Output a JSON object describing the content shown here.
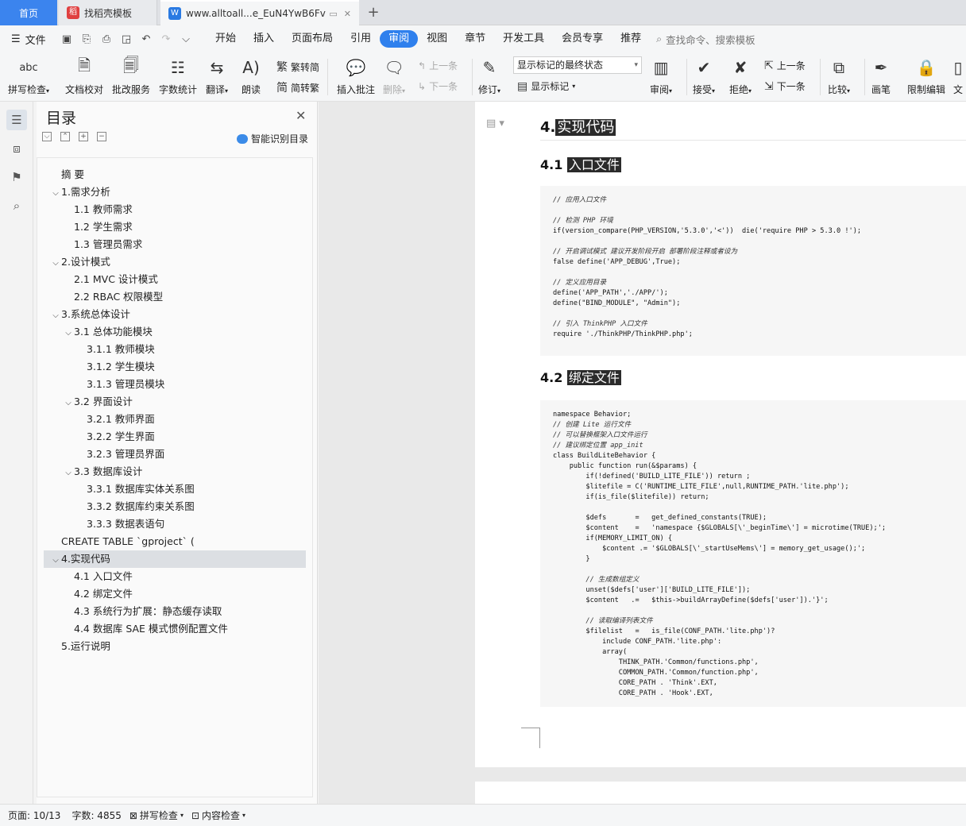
{
  "tabs": {
    "home": "首页",
    "template": "找稻壳模板",
    "document": "www.alltoall...e_EuN4YwB6Fv",
    "add": "+"
  },
  "menu": {
    "file": "文件",
    "tabs": [
      "开始",
      "插入",
      "页面布局",
      "引用",
      "审阅",
      "视图",
      "章节",
      "开发工具",
      "会员专享",
      "推荐"
    ],
    "active_tab": "审阅",
    "search": "查找命令、搜索模板"
  },
  "ribbon": {
    "spellcheck": "拼写检查",
    "doc_proof": "文档校对",
    "batch_service": "批改服务",
    "word_count": "字数统计",
    "translate": "翻译",
    "read_aloud": "朗读",
    "to_traditional": "繁转简",
    "to_simplified": "简转繁",
    "insert_comment": "插入批注",
    "delete": "删除",
    "prev_comment": "上一条",
    "next_comment": "下一条",
    "track_changes": "修订",
    "markup_state": "显示标记的最终状态",
    "show_markup": "显示标记",
    "review": "审阅",
    "accept": "接受",
    "reject": "拒绝",
    "prev_change": "上一条",
    "next_change": "下一条",
    "compare": "比较",
    "pen": "画笔",
    "restrict_edit": "限制编辑",
    "doc_rights": "文"
  },
  "toc": {
    "title": "目录",
    "smart_recognize": "智能识别目录",
    "items": [
      {
        "text": "摘 要",
        "level": 1,
        "exp": ""
      },
      {
        "text": "1.需求分析",
        "level": 1,
        "exp": "⌵"
      },
      {
        "text": "1.1 教师需求",
        "level": 2,
        "exp": ""
      },
      {
        "text": "1.2 学生需求",
        "level": 2,
        "exp": ""
      },
      {
        "text": "1.3 管理员需求",
        "level": 2,
        "exp": ""
      },
      {
        "text": "2.设计模式",
        "level": 1,
        "exp": "⌵"
      },
      {
        "text": "2.1 MVC 设计模式",
        "level": 2,
        "exp": ""
      },
      {
        "text": "2.2 RBAC 权限模型",
        "level": 2,
        "exp": ""
      },
      {
        "text": "3.系统总体设计",
        "level": 1,
        "exp": "⌵"
      },
      {
        "text": "3.1 总体功能模块",
        "level": 2,
        "exp": "⌵"
      },
      {
        "text": "3.1.1 教师模块",
        "level": 3,
        "exp": ""
      },
      {
        "text": "3.1.2 学生模块",
        "level": 3,
        "exp": ""
      },
      {
        "text": "3.1.3 管理员模块",
        "level": 3,
        "exp": ""
      },
      {
        "text": "3.2 界面设计",
        "level": 2,
        "exp": "⌵"
      },
      {
        "text": "3.2.1 教师界面",
        "level": 3,
        "exp": ""
      },
      {
        "text": "3.2.2 学生界面",
        "level": 3,
        "exp": ""
      },
      {
        "text": "3.2.3 管理员界面",
        "level": 3,
        "exp": ""
      },
      {
        "text": "3.3 数据库设计",
        "level": 2,
        "exp": "⌵"
      },
      {
        "text": "3.3.1 数据库实体关系图",
        "level": 3,
        "exp": ""
      },
      {
        "text": "3.3.2 数据库约束关系图",
        "level": 3,
        "exp": ""
      },
      {
        "text": "3.3.3 数据表语句",
        "level": 3,
        "exp": ""
      },
      {
        "text": "CREATE TABLE `gproject` (",
        "level": 1,
        "exp": ""
      },
      {
        "text": "4.实现代码",
        "level": 1,
        "exp": "⌵"
      },
      {
        "text": "4.1 入口文件",
        "level": 2,
        "exp": ""
      },
      {
        "text": "4.2 绑定文件",
        "level": 2,
        "exp": ""
      },
      {
        "text": "4.3 系统行为扩展：静态缓存读取",
        "level": 2,
        "exp": ""
      },
      {
        "text": "4.4 数据库 SAE 模式惯例配置文件",
        "level": 2,
        "exp": ""
      },
      {
        "text": "5.运行说明",
        "level": 1,
        "exp": ""
      }
    ],
    "selected_index": 22
  },
  "document": {
    "h1_num": "4.",
    "h1_text": "实现代码",
    "h2a_num": "4.1 ",
    "h2a_text": "入口文件",
    "h2b_num": "4.2 ",
    "h2b_text": "绑定文件",
    "code_entry": [
      {
        "t": "// 应用入口文件",
        "c": true
      },
      {
        "t": "",
        "c": false
      },
      {
        "t": "// 检测 PHP 环境",
        "c": true
      },
      {
        "t": "if(version_compare(PHP_VERSION,'5.3.0','<'))  die('require PHP > 5.3.0 !');",
        "c": false
      },
      {
        "t": "",
        "c": false
      },
      {
        "t": "// 开启调试模式 建议开发阶段开启 部署阶段注释或者设为",
        "c": true
      },
      {
        "t": "false define('APP_DEBUG',True);",
        "c": false
      },
      {
        "t": "",
        "c": false
      },
      {
        "t": "// 定义应用目录",
        "c": true
      },
      {
        "t": "define('APP_PATH','./APP/');",
        "c": false
      },
      {
        "t": "define(\"BIND_MODULE\", \"Admin\");",
        "c": false
      },
      {
        "t": "",
        "c": false
      },
      {
        "t": "// 引入 ThinkPHP 入口文件",
        "c": true
      },
      {
        "t": "require './ThinkPHP/ThinkPHP.php';",
        "c": false
      }
    ],
    "code_bind": [
      {
        "t": "namespace Behavior;",
        "c": false
      },
      {
        "t": "// 创建 Lite 运行文件",
        "c": true
      },
      {
        "t": "// 可以替换框架入口文件运行",
        "c": true
      },
      {
        "t": "// 建议绑定位置 app_init",
        "c": true
      },
      {
        "t": "class BuildLiteBehavior {",
        "c": false
      },
      {
        "t": "    public function run(&$params) {",
        "c": false
      },
      {
        "t": "        if(!defined('BUILD_LITE_FILE')) return ;",
        "c": false
      },
      {
        "t": "        $litefile = C('RUNTIME_LITE_FILE',null,RUNTIME_PATH.'lite.php');",
        "c": false
      },
      {
        "t": "        if(is_file($litefile)) return;",
        "c": false
      },
      {
        "t": "",
        "c": false
      },
      {
        "t": "        $defs       =   get_defined_constants(TRUE);",
        "c": false
      },
      {
        "t": "        $content    =   'namespace {$GLOBALS[\\'_beginTime\\'] = microtime(TRUE);';",
        "c": false
      },
      {
        "t": "        if(MEMORY_LIMIT_ON) {",
        "c": false
      },
      {
        "t": "            $content .= '$GLOBALS[\\'_startUseMems\\'] = memory_get_usage();';",
        "c": false
      },
      {
        "t": "        }",
        "c": false
      },
      {
        "t": "",
        "c": false
      },
      {
        "t": "        // 生成数组定义",
        "c": true
      },
      {
        "t": "        unset($defs['user']['BUILD_LITE_FILE']);",
        "c": false
      },
      {
        "t": "        $content   .=   $this->buildArrayDefine($defs['user']).'}';",
        "c": false
      },
      {
        "t": "",
        "c": false
      },
      {
        "t": "        // 读取编译列表文件",
        "c": true
      },
      {
        "t": "        $filelist   =   is_file(CONF_PATH.'lite.php')?",
        "c": false
      },
      {
        "t": "            include CONF_PATH.'lite.php':",
        "c": false
      },
      {
        "t": "            array(",
        "c": false
      },
      {
        "t": "                THINK_PATH.'Common/functions.php',",
        "c": false
      },
      {
        "t": "                COMMON_PATH.'Common/function.php',",
        "c": false
      },
      {
        "t": "                CORE_PATH . 'Think'.EXT,",
        "c": false
      },
      {
        "t": "                CORE_PATH . 'Hook'.EXT,",
        "c": false
      }
    ]
  },
  "status": {
    "page": "页面: 10/13",
    "words": "字数: 4855",
    "spellcheck": "拼写检查",
    "content_check": "内容检查"
  }
}
